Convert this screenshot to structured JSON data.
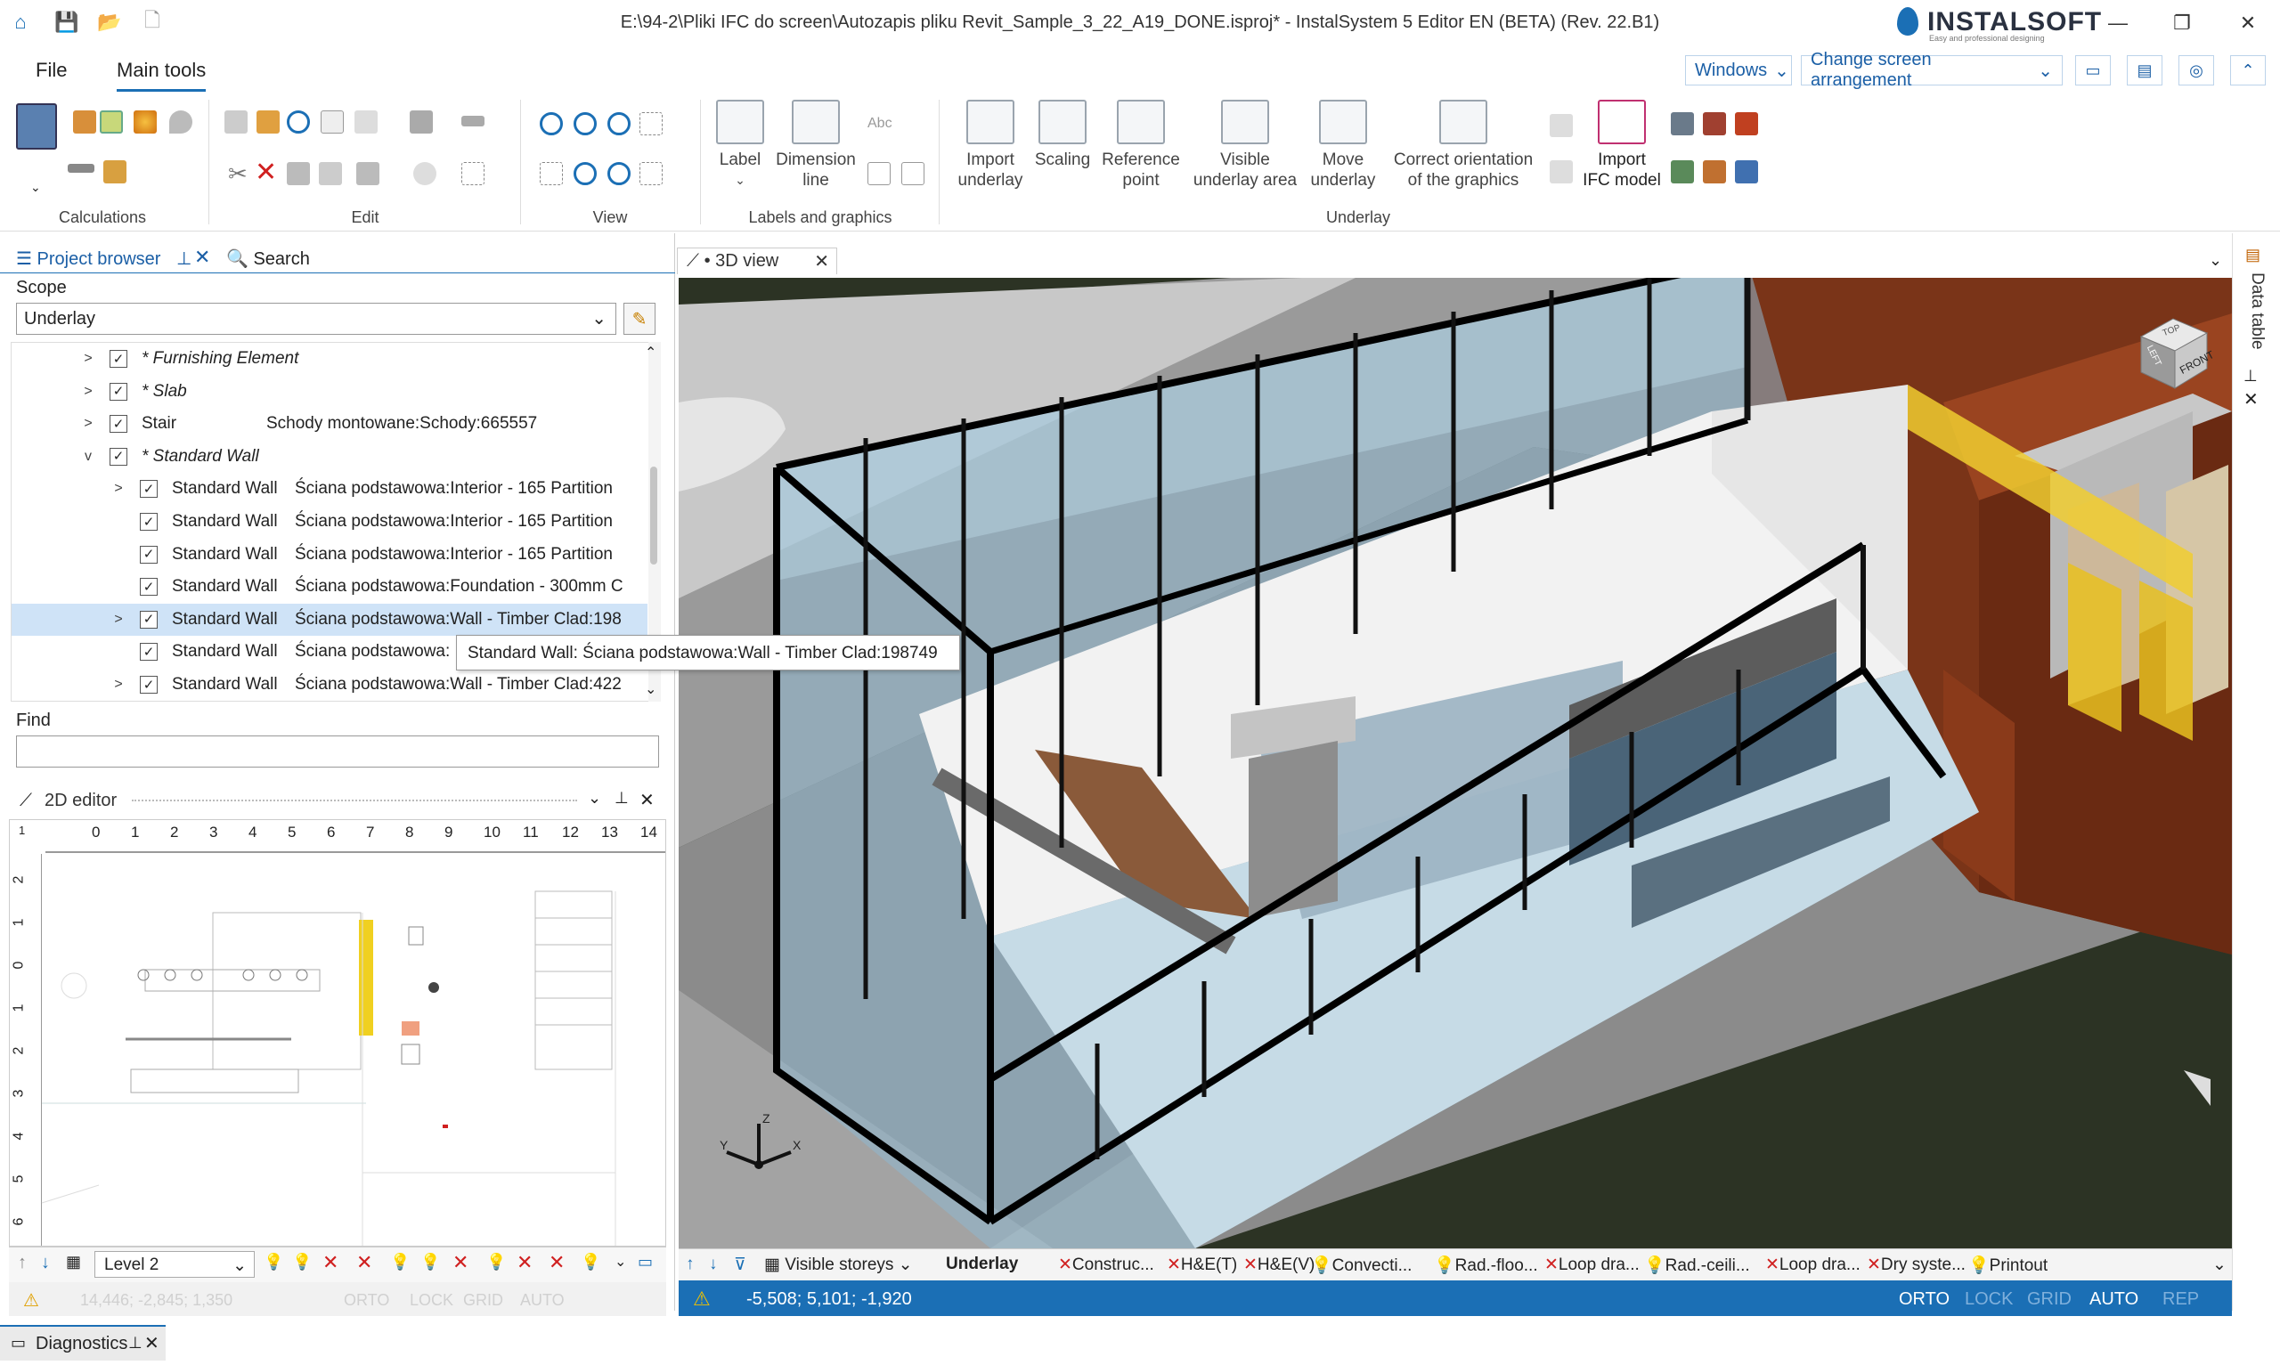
{
  "window": {
    "title": "E:\\94-2\\Pliki IFC do screen\\Autozapis pliku Revit_Sample_3_22_A19_DONE.isproj* - InstalSystem 5 Editor EN (BETA) (Rev. 22.B1)",
    "brand_name": "INSTALSOFT",
    "brand_tagline": "Easy and professional designing"
  },
  "menu": {
    "file": "File",
    "main_tools": "Main tools",
    "windows": "Windows",
    "change_arrangement": "Change screen arrangement"
  },
  "ribbon": {
    "groups": {
      "calculations": "Calculations",
      "edit": "Edit",
      "view": "View",
      "labels_graphics": "Labels and graphics",
      "underlay": "Underlay"
    },
    "label": "Label",
    "dimension_line_1": "Dimension",
    "dimension_line_2": "line",
    "abc": "Abc",
    "import_underlay_1": "Import",
    "import_underlay_2": "underlay",
    "scaling": "Scaling",
    "reference_point_1": "Reference",
    "reference_point_2": "point",
    "visible_area_1": "Visible",
    "visible_area_2": "underlay area",
    "move_underlay_1": "Move",
    "move_underlay_2": "underlay",
    "correct_orientation_1": "Correct orientation",
    "correct_orientation_2": "of the graphics",
    "import_ifc_1": "Import",
    "import_ifc_2": "IFC model"
  },
  "project_browser": {
    "tab_label": "Project browser",
    "search_tab": "Search",
    "scope_label": "Scope",
    "scope_value": "Underlay",
    "find_label": "Find",
    "tree": [
      {
        "category": "* Furnishing Element",
        "name": "",
        "italic": true,
        "level": 0,
        "expander": ">",
        "checked": true,
        "selected": false
      },
      {
        "category": "* Slab",
        "name": "",
        "italic": true,
        "level": 0,
        "expander": ">",
        "checked": true,
        "selected": false
      },
      {
        "category": "Stair",
        "name": "Schody montowane:Schody:665557",
        "italic": false,
        "level": 0,
        "expander": ">",
        "checked": true,
        "selected": false
      },
      {
        "category": "* Standard Wall",
        "name": "",
        "italic": true,
        "level": 0,
        "expander": "v",
        "checked": true,
        "selected": false
      },
      {
        "category": "Standard Wall",
        "name": "Ściana podstawowa:Interior - 165 Partition",
        "italic": false,
        "level": 1,
        "expander": ">",
        "checked": true,
        "selected": false
      },
      {
        "category": "Standard Wall",
        "name": "Ściana podstawowa:Interior - 165 Partition",
        "italic": false,
        "level": 1,
        "expander": "",
        "checked": true,
        "selected": false
      },
      {
        "category": "Standard Wall",
        "name": "Ściana podstawowa:Interior - 165 Partition",
        "italic": false,
        "level": 1,
        "expander": "",
        "checked": true,
        "selected": false
      },
      {
        "category": "Standard Wall",
        "name": "Ściana podstawowa:Foundation - 300mm C",
        "italic": false,
        "level": 1,
        "expander": "",
        "checked": true,
        "selected": false
      },
      {
        "category": "Standard Wall",
        "name": "Ściana podstawowa:Wall - Timber Clad:198",
        "italic": false,
        "level": 1,
        "expander": ">",
        "checked": true,
        "selected": true
      },
      {
        "category": "Standard Wall",
        "name": "Ściana podstawowa:",
        "italic": false,
        "level": 1,
        "expander": "",
        "checked": true,
        "selected": false
      },
      {
        "category": "Standard Wall",
        "name": "Ściana podstawowa:Wall - Timber Clad:422",
        "italic": false,
        "level": 1,
        "expander": ">",
        "checked": true,
        "selected": false
      }
    ],
    "tooltip": "Standard Wall: Ściana podstawowa:Wall - Timber Clad:198749"
  },
  "editor2d": {
    "title": "2D editor",
    "ruler_x": [
      "1",
      "0",
      "1",
      "2",
      "3",
      "4",
      "5",
      "6",
      "7",
      "8",
      "9",
      "10",
      "11",
      "12",
      "13",
      "14"
    ],
    "ruler_y": [
      "2",
      "1",
      "0",
      "1",
      "2",
      "3",
      "4",
      "5",
      "6"
    ],
    "level": "Level 2",
    "status_coords": "14,446; -2,845; 1,350",
    "status_flags": [
      "ORTO",
      "LOCK",
      "GRID",
      "AUTO"
    ]
  },
  "view3d": {
    "tab_label": "• 3D view",
    "cube_top": "TOP",
    "cube_front": "FRONT",
    "cube_left": "LEFT",
    "axis_x": "X",
    "axis_y": "Y",
    "axis_z": "Z",
    "visible_storeys": "Visible storeys",
    "layers": [
      "Underlay",
      "Construc...",
      "H&E(T)",
      "H&E(V)",
      "Convecti...",
      "Rad.-floo...",
      "Loop dra...",
      "Rad.-ceili...",
      "Loop dra...",
      "Dry syste...",
      "Printout"
    ],
    "coords": "-5,508; 5,101; -1,920",
    "flags": [
      "ORTO",
      "LOCK",
      "GRID",
      "AUTO",
      "REP"
    ]
  },
  "side_panel": {
    "data_table": "Data table"
  },
  "diagnostics": {
    "label": "Diagnostics"
  },
  "colors": {
    "accent": "#1b6fb5",
    "highlight": "#e8c020",
    "glass": "#8fb8cf",
    "brick": "#8a3a1a"
  }
}
